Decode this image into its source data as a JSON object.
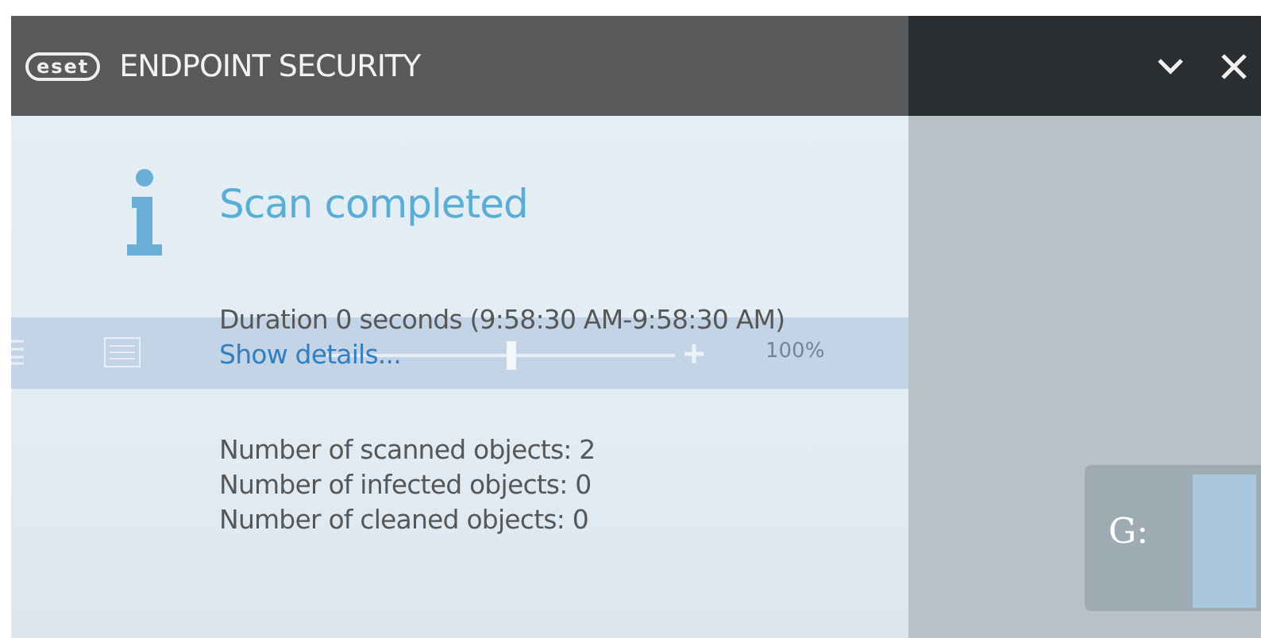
{
  "title_bar": {
    "logo": "eset",
    "title": "ENDPOINT SECURITY"
  },
  "notification": {
    "heading": "Scan completed",
    "duration": "Duration 0 seconds (9:58:30 AM-9:58:30 AM)",
    "link": "Show details...",
    "stats": [
      "Number of scanned objects: 2",
      "Number of infected objects: 0",
      "Number of cleaned objects: 0"
    ]
  },
  "background": {
    "level": 0.53,
    "zoom": "100%",
    "drive": "G:"
  }
}
